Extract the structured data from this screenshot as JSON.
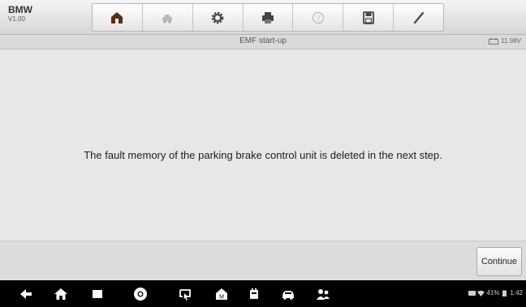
{
  "brand": {
    "name": "BMW",
    "version": "V1.00"
  },
  "toolbar": {
    "items": [
      {
        "icon": "home-icon"
      },
      {
        "icon": "vehicle-swap-icon"
      },
      {
        "icon": "settings-icon"
      },
      {
        "icon": "print-icon"
      },
      {
        "icon": "help-icon"
      },
      {
        "icon": "save-icon"
      },
      {
        "icon": "edit-icon"
      }
    ]
  },
  "screen": {
    "title": "EMF start-up",
    "battery_voltage": "11.98V"
  },
  "main": {
    "message": "The fault memory of the parking brake control unit is deleted in the next step."
  },
  "actions": {
    "continue_label": "Continue"
  },
  "statusbar": {
    "battery_percent": "41%",
    "time": "1:42"
  },
  "colors": {
    "accent_active": "#5a2a1a",
    "disabled": "#a9a9a9",
    "navbar_bg": "#000000"
  }
}
